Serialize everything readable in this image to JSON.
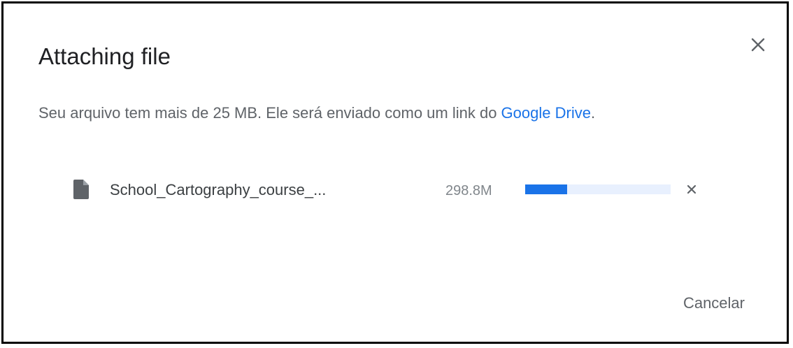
{
  "dialog": {
    "title": "Attaching file",
    "message_prefix": "Seu arquivo tem mais de 25 MB. Ele será enviado como um link do ",
    "message_link": "Google Drive",
    "message_suffix": ".",
    "close_icon": "close-icon",
    "cancel_label": "Cancelar"
  },
  "file": {
    "name": "School_Cartography_course_...",
    "size": "298.8M",
    "progress_fraction": 0.29,
    "icon": "file-icon",
    "remove_icon": "remove-icon"
  },
  "colors": {
    "accent": "#1a73e8",
    "track": "#e8f0fe",
    "text_secondary": "#5f6368"
  }
}
